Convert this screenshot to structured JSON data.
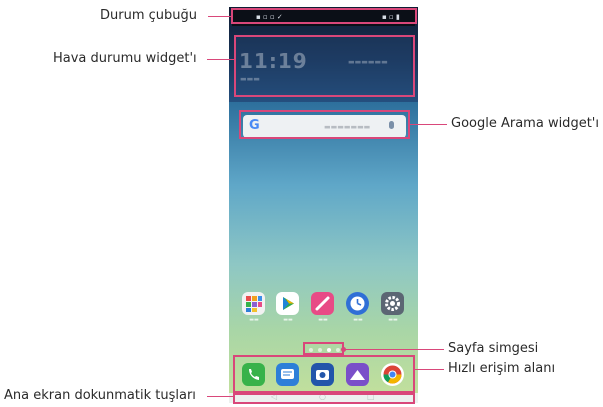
{
  "labels": {
    "status_bar": "Durum çubuğu",
    "weather_widget": "Hava durumu widget'ı",
    "google_search_widget": "Google Arama widget'ı",
    "page_icon": "Sayfa simgesi",
    "quick_access": "Hızlı erişim alanı",
    "home_touch_keys": "Ana ekran dokunmatik tuşları"
  },
  "phone": {
    "status_left": "▪ ▫ ▫ ✓",
    "status_right": "▪ ▫ ▮",
    "weather_time": "11:19",
    "google_logo": "G",
    "nav_back": "◁",
    "nav_home": "○",
    "nav_recent": "□"
  },
  "apps": [
    {
      "name": "apps-folder-icon",
      "color": "#f2f2f2"
    },
    {
      "name": "play-store-icon",
      "color": "#ffffff"
    },
    {
      "name": "notes-icon",
      "color": "#e84b86"
    },
    {
      "name": "clock-icon",
      "color": "#2f6fd6"
    },
    {
      "name": "settings-icon",
      "color": "#5b6673"
    }
  ],
  "dock_apps": [
    {
      "name": "phone-icon",
      "color": "#38b24a"
    },
    {
      "name": "messages-icon",
      "color": "#2d7fd8"
    },
    {
      "name": "camera-icon",
      "color": "#2255aa"
    },
    {
      "name": "gallery-icon",
      "color": "#7a4fc9"
    },
    {
      "name": "chrome-icon",
      "color": "#ffffff"
    }
  ],
  "colors": {
    "callout": "#d9477a"
  }
}
